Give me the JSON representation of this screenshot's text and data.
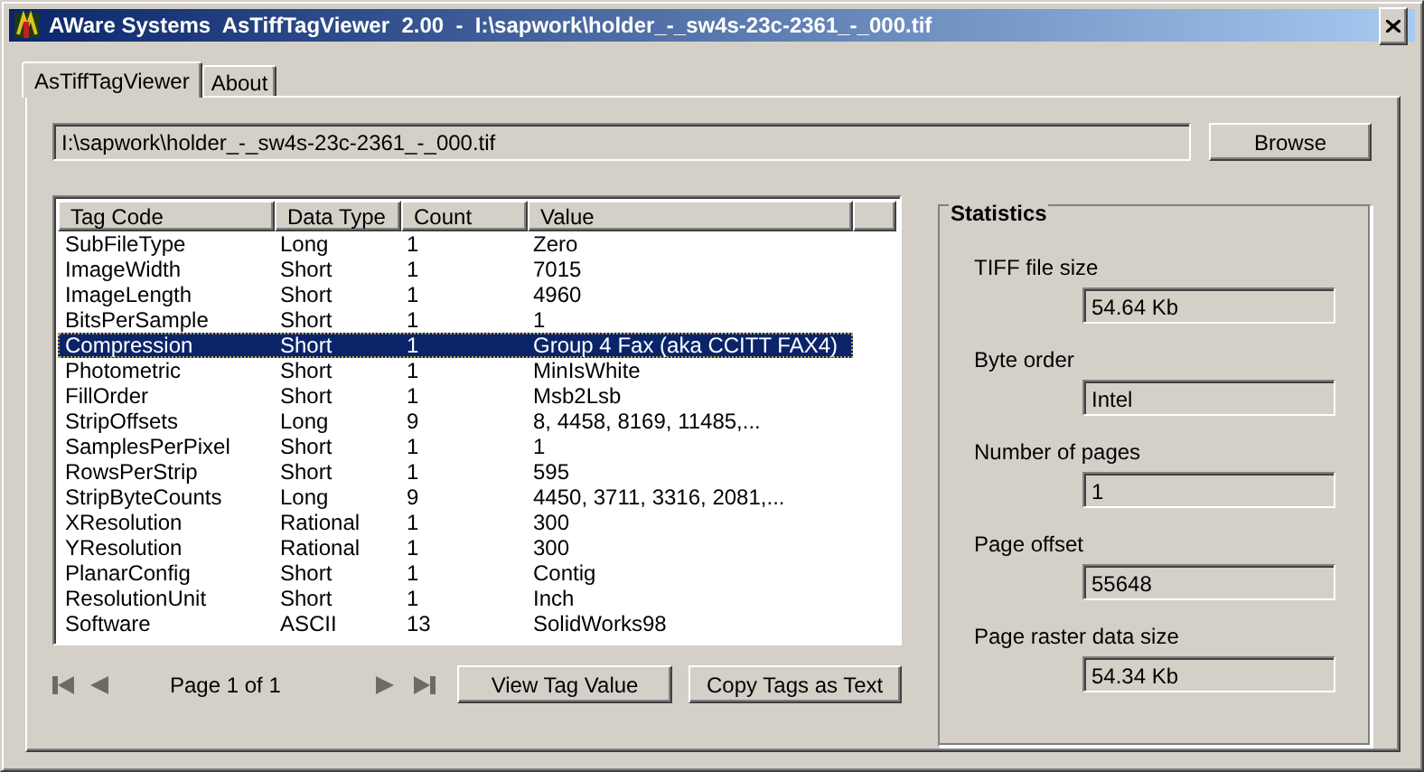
{
  "window": {
    "title": "AWare Systems  AsTiffTagViewer  2.00  -  I:\\sapwork\\holder_-_sw4s-23c-2361_-_000.tif"
  },
  "tabs": [
    {
      "label": "AsTiffTagViewer",
      "selected": true
    },
    {
      "label": "About",
      "selected": false
    }
  ],
  "file_path": {
    "value": "I:\\sapwork\\holder_-_sw4s-23c-2361_-_000.tif"
  },
  "browse_button": "Browse",
  "table": {
    "columns": [
      "Tag Code",
      "Data Type",
      "Count",
      "Value"
    ],
    "rows": [
      {
        "cells": [
          "SubFileType",
          "Long",
          "1",
          "Zero"
        ],
        "selected": false
      },
      {
        "cells": [
          "ImageWidth",
          "Short",
          "1",
          "7015"
        ],
        "selected": false
      },
      {
        "cells": [
          "ImageLength",
          "Short",
          "1",
          "4960"
        ],
        "selected": false
      },
      {
        "cells": [
          "BitsPerSample",
          "Short",
          "1",
          "1"
        ],
        "selected": false
      },
      {
        "cells": [
          "Compression",
          "Short",
          "1",
          "Group 4 Fax (aka CCITT FAX4)"
        ],
        "selected": true
      },
      {
        "cells": [
          "Photometric",
          "Short",
          "1",
          "MinIsWhite"
        ],
        "selected": false
      },
      {
        "cells": [
          "FillOrder",
          "Short",
          "1",
          "Msb2Lsb"
        ],
        "selected": false
      },
      {
        "cells": [
          "StripOffsets",
          "Long",
          "9",
          "8, 4458, 8169, 11485,..."
        ],
        "selected": false
      },
      {
        "cells": [
          "SamplesPerPixel",
          "Short",
          "1",
          "1"
        ],
        "selected": false
      },
      {
        "cells": [
          "RowsPerStrip",
          "Short",
          "1",
          "595"
        ],
        "selected": false
      },
      {
        "cells": [
          "StripByteCounts",
          "Long",
          "9",
          "4450, 3711, 3316, 2081,..."
        ],
        "selected": false
      },
      {
        "cells": [
          "XResolution",
          "Rational",
          "1",
          "300"
        ],
        "selected": false
      },
      {
        "cells": [
          "YResolution",
          "Rational",
          "1",
          "300"
        ],
        "selected": false
      },
      {
        "cells": [
          "PlanarConfig",
          "Short",
          "1",
          "Contig"
        ],
        "selected": false
      },
      {
        "cells": [
          "ResolutionUnit",
          "Short",
          "1",
          "Inch"
        ],
        "selected": false
      },
      {
        "cells": [
          "Software",
          "ASCII",
          "13",
          "SolidWorks98"
        ],
        "selected": false
      }
    ]
  },
  "pager": {
    "label": "Page 1 of 1"
  },
  "buttons": [
    "View Tag Value",
    "Copy Tags as Text"
  ],
  "statistics": {
    "title": "Statistics",
    "fields": [
      {
        "label": "TIFF file size",
        "value": "54.64 Kb"
      },
      {
        "label": "Byte order",
        "value": "Intel"
      },
      {
        "label": "Number of pages",
        "value": "1"
      },
      {
        "label": "Page offset",
        "value": "55648"
      },
      {
        "label": "Page raster data size",
        "value": "54.34 Kb"
      }
    ]
  }
}
